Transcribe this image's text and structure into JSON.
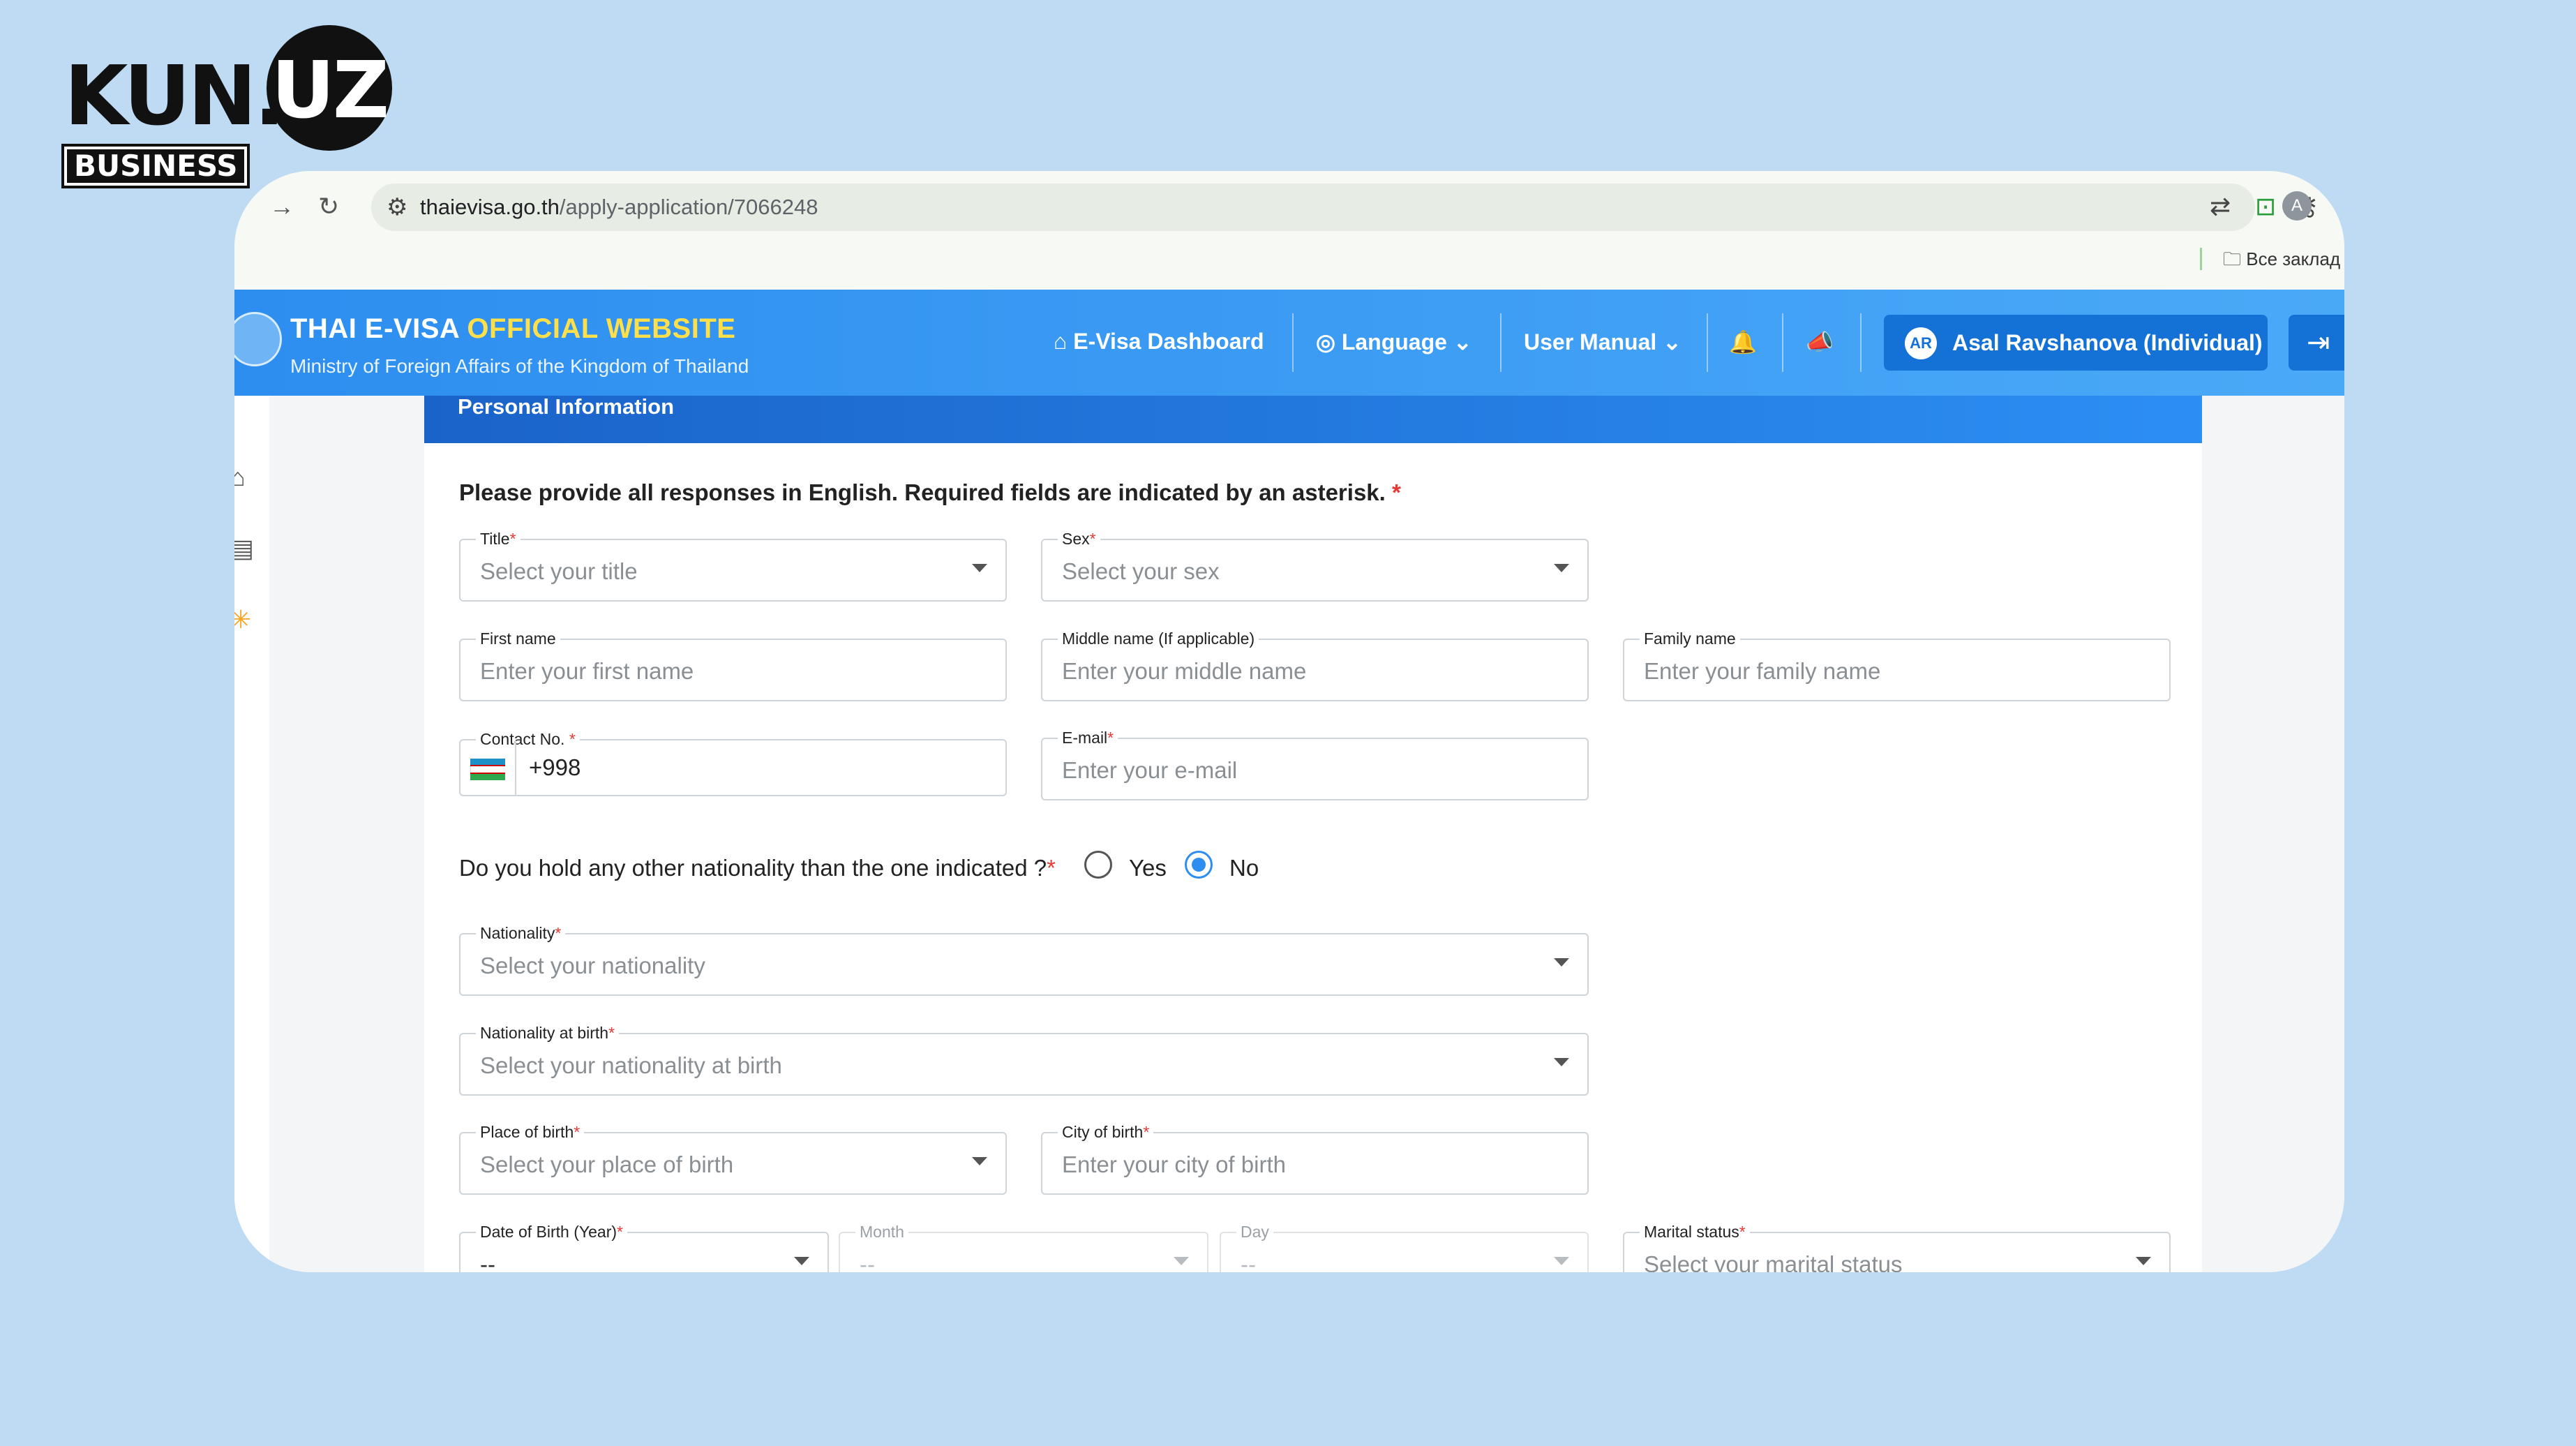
{
  "logo": {
    "part1": "KUN.",
    "part2": "UZ",
    "tagline": "BUSINESS"
  },
  "browser": {
    "url_host": "thaievisa.go.th",
    "url_path": "/apply-application/7066248",
    "profile_initial": "A",
    "bookmarks_label": "Все заклад"
  },
  "site": {
    "title_main": "THAI E-VISA ",
    "title_accent": "OFFICIAL WEBSITE",
    "subtitle": "Ministry of Foreign Affairs of the Kingdom of Thailand",
    "nav": {
      "dashboard": "E-Visa Dashboard",
      "language": "Language",
      "manual": "User Manual"
    },
    "user": {
      "initials": "AR",
      "name": "Asal Ravshanova (Individual)"
    }
  },
  "form": {
    "section_title": "Personal Information",
    "intro": "Please provide all responses in English. Required fields are indicated by an asterisk.",
    "required_mark": "*",
    "title": {
      "label": "Title",
      "placeholder": "Select your title"
    },
    "sex": {
      "label": "Sex",
      "placeholder": "Select your sex"
    },
    "first_name": {
      "label": "First name",
      "placeholder": "Enter your first name"
    },
    "middle_name": {
      "label": "Middle name (If applicable)",
      "placeholder": "Enter your middle name"
    },
    "family_name": {
      "label": "Family name",
      "placeholder": "Enter your family name"
    },
    "contact": {
      "label": "Contact No.",
      "value": "+998"
    },
    "email": {
      "label": "E-mail",
      "placeholder": "Enter your e-mail"
    },
    "other_nationality": {
      "question": "Do you hold any other nationality than the one indicated ?",
      "yes": "Yes",
      "no": "No",
      "selected": "No"
    },
    "nationality": {
      "label": "Nationality",
      "placeholder": "Select your nationality"
    },
    "nationality_birth": {
      "label": "Nationality at birth",
      "placeholder": "Select your nationality at birth"
    },
    "place_birth": {
      "label": "Place of birth",
      "placeholder": "Select your place of birth"
    },
    "city_birth": {
      "label": "City of birth",
      "placeholder": "Enter your city of birth"
    },
    "dob_year": {
      "label": "Date of Birth (Year)",
      "placeholder": "--"
    },
    "dob_month": {
      "label": "Month",
      "placeholder": "--"
    },
    "dob_day": {
      "label": "Day",
      "placeholder": "--"
    },
    "marital": {
      "label": "Marital status",
      "placeholder": "Select your marital status"
    }
  }
}
